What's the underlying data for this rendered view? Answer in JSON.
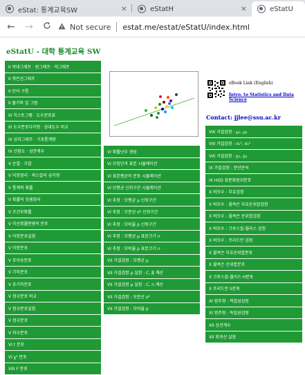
{
  "browser": {
    "tabs": [
      {
        "title": "eStat: 통계교육SW",
        "active": false
      },
      {
        "title": "eStatH",
        "active": false
      },
      {
        "title": "eStatU",
        "active": true
      }
    ],
    "close_glyph": "×",
    "new_tab_glyph": "+",
    "back_glyph": "←",
    "forward_glyph": "→",
    "reload_glyph": "C",
    "security_label": "Not secure",
    "url": "estat.me/estat/eStatU/index.html"
  },
  "site": {
    "title": "eStatU - 대학 통계교육 SW",
    "ebook_label": "eBook Link (English)",
    "ebook_link": "Intro. to Statistics and Data Science",
    "contact": "Contact: jjlee@ssu.ac.kr"
  },
  "menu_col1": [
    "II  막대그래프 · 원그래프 · 띠그래프",
    "II  꺾은선그래프",
    "II  단어 구름",
    "II  줄기와 잎 그림",
    "III  히스토그램 · 도수분포표",
    "III  도수분포다각형 · 상대도수 비교",
    "IV  상자그래프 · 기초통계량",
    "IV  산점도 · 상관계수",
    "V  순열 · 조합",
    "V  이항정리 · 파스칼의 삼각형",
    "V  통계적 확률",
    "V  확률의 덧셈정리",
    "V  조건부확률",
    "V  이산확률변량의 분포",
    "V  이항분포실험",
    "V  이항분포",
    "V  포아송분포",
    "V  기하분포",
    "V  초기하분포",
    "V  정규분포 비교",
    "V  정규분포실험",
    "V  정규분포",
    "V  지수분포",
    "VI  t 분포",
    "VI  χ² 분포",
    "VIII  F 분포"
  ],
  "menu_col2": [
    "VI  확률난수 생성",
    "VI  모집단과 표본 시뮬레이션",
    "VI  표본평균의 분포 시뮬레이션",
    "VI  모평균 신뢰구간 시뮬레이션",
    "VI  추정 : 모평균 μ 신뢰구간",
    "VI  추정 : 모분산 σ² 신뢰구간",
    "VI  추정 : 모비율 p 신뢰구간",
    "VI  추정 : 모평균 μ 표본크기 n",
    "VI  추정 : 모비율 p 표본크기 n",
    "VII  가설검정 : 모평균 μ",
    "VII  가설검정 μ 실험 : C, β 계산",
    "VII  가설검정 μ 실험 : C, n 계산",
    "VII  가설검정 : 모분산 σ²",
    "VII  가설검정 : 모비율 p"
  ],
  "menu_col3": [
    "VIII  가설검정 : μ₁, μ₂",
    "VIII  가설검정 : σ₁², σ₂²",
    "VIII  가설검정 : p₁, p₂",
    "IX  가설검정 : 분산분석",
    "IX  HSD 표준화범위분포",
    "X  비모수 : 부호검정",
    "X  비모수 : 윌콕슨 부호순위합검정",
    "X  비모수 : 윌콕슨 순위합검정",
    "X  비모수 : 크루스칼-월리스 검정",
    "X  비모수 : 프리드만 검정",
    "X  윌콕슨 부호순위합분포",
    "X  윌콕슨 순위합분포",
    "X  크루스칼-월리스 H분포",
    "X  프리드만 S분포",
    "XI  범주형 : 적합성검정",
    "XI  범주형 : 독립성검정",
    "XII  상관계수",
    "XII  회귀선 실험"
  ],
  "colors": {
    "menu_green": "#1f9a35",
    "title_green": "#1d8b2f",
    "link_blue": "#0000cc"
  },
  "icons": [
    "estat-favicon",
    "globe-icon",
    "warning-icon",
    "qr-code-icon"
  ]
}
